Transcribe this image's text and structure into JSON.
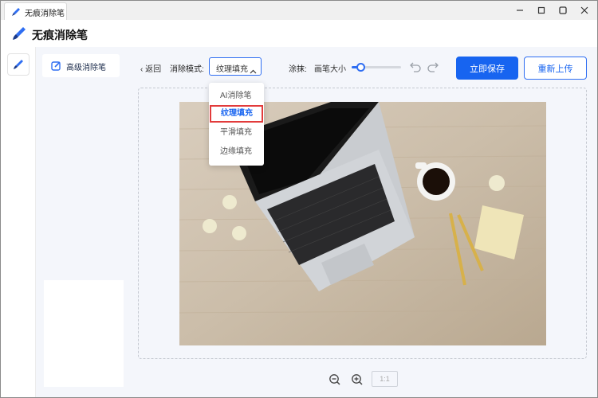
{
  "window": {
    "tab_title": "无痕消除笔",
    "controls": [
      "minimize",
      "restore",
      "close"
    ]
  },
  "app": {
    "title": "无痕消除笔"
  },
  "sidebar": {
    "items": [
      {
        "label": "高级消除笔",
        "icon": "edit-square-icon"
      }
    ]
  },
  "toolbar": {
    "back_label": "返回",
    "mode_label": "消除模式:",
    "mode_value": "纹理填充",
    "brush_label": "涂抹:",
    "brush_size_label": "画笔大小",
    "brush_size_level": 0.18,
    "save_label": "立即保存",
    "reupload_label": "重新上传"
  },
  "mode_dropdown": {
    "options": [
      "AI消除笔",
      "纹理填充",
      "平滑填充",
      "边缘填充"
    ],
    "selected": "纹理填充"
  },
  "footer": {
    "ratio_label": "1:1"
  },
  "colors": {
    "accent": "#1764f0",
    "sidebar_bg": "#f4f6fb",
    "highlight_border": "#e23b3b"
  }
}
